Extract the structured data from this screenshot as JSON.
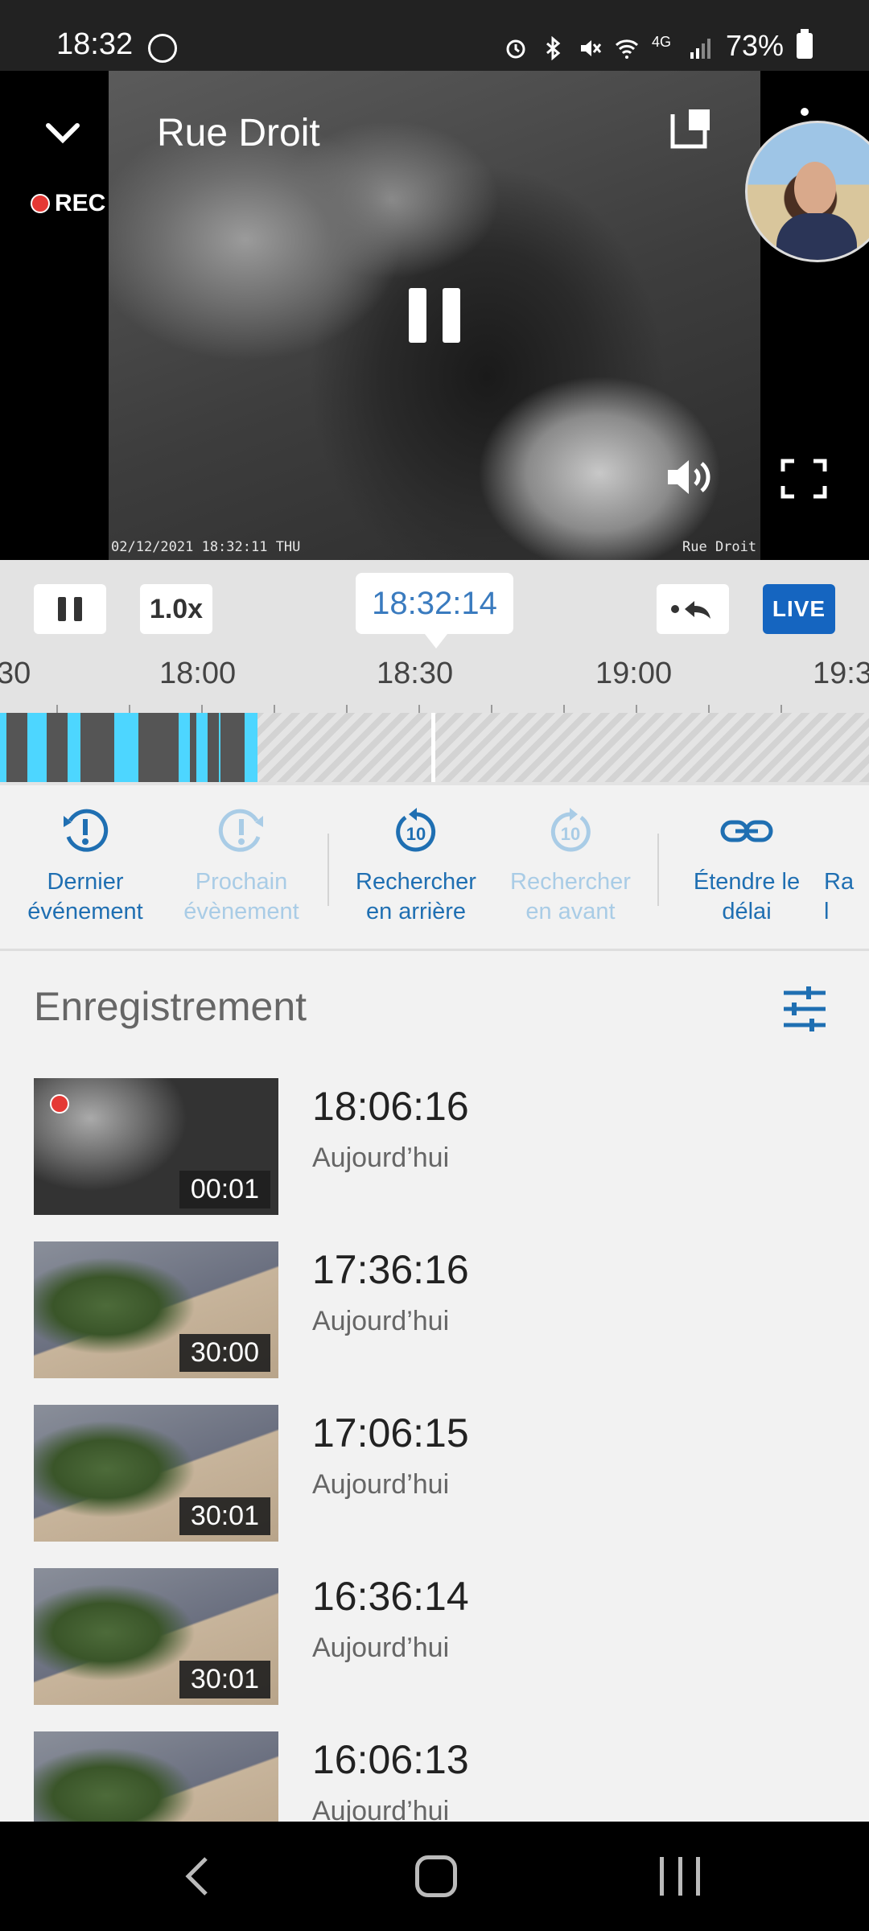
{
  "status_bar": {
    "time": "18:32",
    "battery": "73%"
  },
  "camera": {
    "title": "Rue Droit",
    "rec_label": "REC",
    "overlay_datetime": "02/12/2021 18:32:11 THU",
    "overlay_name": "Rue Droit"
  },
  "player": {
    "speed": "1.0x",
    "current_time": "18:32:14",
    "live_label": "LIVE"
  },
  "timeline": {
    "ticks": [
      "30",
      "18:00",
      "18:30",
      "19:00",
      "19:3"
    ],
    "accent_color": "#4dd6ff",
    "recorded_color": "#555555"
  },
  "actions": {
    "last_event": [
      "Dernier",
      "événement"
    ],
    "next_event": [
      "Prochain",
      "évènement"
    ],
    "seek_back": [
      "Rechercher",
      "en arrière"
    ],
    "seek_forward": [
      "Rechercher",
      "en avant"
    ],
    "extend": [
      "Étendre le",
      "délai"
    ],
    "partial": [
      "Ra",
      "l"
    ],
    "seek_amount": "10"
  },
  "recordings": {
    "heading": "Enregistrement",
    "items": [
      {
        "time": "18:06:16",
        "day": "Aujourd’hui",
        "duration": "00:01",
        "type": "night",
        "event": true
      },
      {
        "time": "17:36:16",
        "day": "Aujourd’hui",
        "duration": "30:00",
        "type": "day",
        "event": false
      },
      {
        "time": "17:06:15",
        "day": "Aujourd’hui",
        "duration": "30:01",
        "type": "day",
        "event": false
      },
      {
        "time": "16:36:14",
        "day": "Aujourd’hui",
        "duration": "30:01",
        "type": "day",
        "event": false
      },
      {
        "time": "16:06:13",
        "day": "Aujourd’hui",
        "duration": "",
        "type": "day",
        "event": false
      }
    ]
  }
}
